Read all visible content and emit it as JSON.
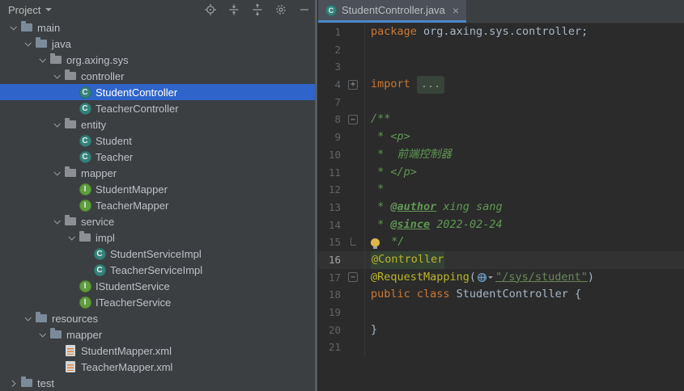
{
  "project_panel": {
    "title": "Project",
    "toolbar_icons": [
      {
        "name": "locate"
      },
      {
        "name": "collapse-all"
      },
      {
        "name": "expand-all"
      },
      {
        "name": "settings"
      },
      {
        "name": "hide"
      }
    ],
    "tree": [
      {
        "label": "main",
        "indent": 0,
        "chevron": "open",
        "icon": "folder"
      },
      {
        "label": "java",
        "indent": 1,
        "chevron": "open",
        "icon": "folder"
      },
      {
        "label": "org.axing.sys",
        "indent": 2,
        "chevron": "open",
        "icon": "package"
      },
      {
        "label": "controller",
        "indent": 3,
        "chevron": "open",
        "icon": "package"
      },
      {
        "label": "StudentController",
        "indent": 4,
        "chevron": "none",
        "icon": "class",
        "selected": true
      },
      {
        "label": "TeacherController",
        "indent": 4,
        "chevron": "none",
        "icon": "class"
      },
      {
        "label": "entity",
        "indent": 3,
        "chevron": "open",
        "icon": "package"
      },
      {
        "label": "Student",
        "indent": 4,
        "chevron": "none",
        "icon": "class"
      },
      {
        "label": "Teacher",
        "indent": 4,
        "chevron": "none",
        "icon": "class"
      },
      {
        "label": "mapper",
        "indent": 3,
        "chevron": "open",
        "icon": "package"
      },
      {
        "label": "StudentMapper",
        "indent": 4,
        "chevron": "none",
        "icon": "interface"
      },
      {
        "label": "TeacherMapper",
        "indent": 4,
        "chevron": "none",
        "icon": "interface"
      },
      {
        "label": "service",
        "indent": 3,
        "chevron": "open",
        "icon": "package"
      },
      {
        "label": "impl",
        "indent": 4,
        "chevron": "open",
        "icon": "package"
      },
      {
        "label": "StudentServiceImpl",
        "indent": 5,
        "chevron": "none",
        "icon": "class"
      },
      {
        "label": "TeacherServiceImpl",
        "indent": 5,
        "chevron": "none",
        "icon": "class"
      },
      {
        "label": "IStudentService",
        "indent": 4,
        "chevron": "none",
        "icon": "interface"
      },
      {
        "label": "ITeacherService",
        "indent": 4,
        "chevron": "none",
        "icon": "interface"
      },
      {
        "label": "resources",
        "indent": 1,
        "chevron": "open",
        "icon": "folder"
      },
      {
        "label": "mapper",
        "indent": 2,
        "chevron": "open",
        "icon": "folder"
      },
      {
        "label": "StudentMapper.xml",
        "indent": 3,
        "chevron": "none",
        "icon": "xml"
      },
      {
        "label": "TeacherMapper.xml",
        "indent": 3,
        "chevron": "none",
        "icon": "xml"
      },
      {
        "label": "test",
        "indent": 0,
        "chevron": "closed",
        "icon": "folder"
      }
    ]
  },
  "editor": {
    "tab": {
      "title": "StudentController.java",
      "close_label": "×"
    },
    "lines": [
      {
        "n": "1",
        "t": [
          [
            "kw",
            "package "
          ],
          [
            "pl",
            "org.axing.sys.controller;"
          ]
        ]
      },
      {
        "n": "2",
        "t": []
      },
      {
        "n": "3",
        "t": []
      },
      {
        "n": "4",
        "g": "plus",
        "t": [
          [
            "kw",
            "import "
          ],
          [
            "fold",
            "..."
          ]
        ]
      },
      {
        "n": "7",
        "t": []
      },
      {
        "n": "8",
        "g": "minus",
        "t": [
          [
            "doc",
            "/**"
          ]
        ]
      },
      {
        "n": "9",
        "t": [
          [
            "doc",
            " * <p>"
          ]
        ]
      },
      {
        "n": "10",
        "t": [
          [
            "doc",
            " *  前端控制器"
          ]
        ]
      },
      {
        "n": "11",
        "t": [
          [
            "doc",
            " * </p>"
          ]
        ]
      },
      {
        "n": "12",
        "t": [
          [
            "doc",
            " *"
          ]
        ]
      },
      {
        "n": "13",
        "t": [
          [
            "doc",
            " * "
          ],
          [
            "doctag",
            "@author"
          ],
          [
            "docval",
            " xing sang"
          ]
        ]
      },
      {
        "n": "14",
        "t": [
          [
            "doc",
            " * "
          ],
          [
            "doctag",
            "@since"
          ],
          [
            "docval",
            " 2022-02-24"
          ]
        ]
      },
      {
        "n": "15",
        "g": "end",
        "t": [
          [
            "bulb",
            ""
          ],
          [
            "doc",
            " */"
          ]
        ]
      },
      {
        "n": "16",
        "cur": true,
        "t": [
          [
            "annhl",
            "@Controller"
          ]
        ]
      },
      {
        "n": "17",
        "g": "minus",
        "t": [
          [
            "ann",
            "@RequestMapping"
          ],
          [
            "pl",
            "("
          ],
          [
            "mapicon",
            ""
          ],
          [
            "str",
            "\"/sys/student\""
          ],
          [
            "pl",
            ")"
          ]
        ]
      },
      {
        "n": "18",
        "t": [
          [
            "kw",
            "public class "
          ],
          [
            "pl",
            "StudentController {"
          ]
        ]
      },
      {
        "n": "19",
        "t": []
      },
      {
        "n": "20",
        "t": [
          [
            "pl",
            "}"
          ]
        ]
      },
      {
        "n": "21",
        "t": []
      }
    ],
    "colors": {
      "keyword": "#cc7832",
      "plain": "#a9b7c6",
      "javadoc": "#629755",
      "annotation": "#bbb529",
      "string": "#6a8759",
      "selection": "#2f65ca",
      "current_line": "#323232",
      "tab_underline": "#4a88c7"
    }
  }
}
